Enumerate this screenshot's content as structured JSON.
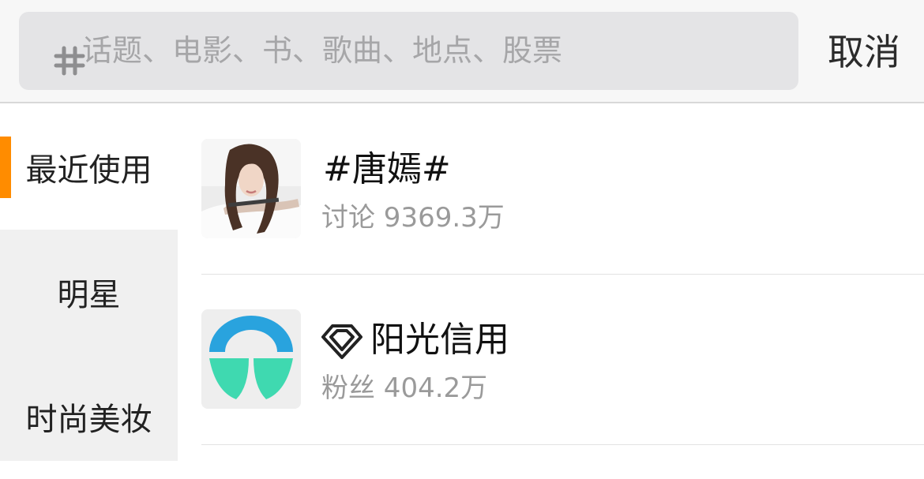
{
  "search": {
    "icon": "hashtag-icon",
    "placeholder": "话题、电影、书、歌曲、地点、股票"
  },
  "header": {
    "cancel_label": "取消"
  },
  "sidebar": {
    "accent_color": "#ff8c00",
    "items": [
      {
        "label": "最近使用",
        "active": true
      },
      {
        "label": "明星",
        "active": false
      },
      {
        "label": "时尚美妆",
        "active": false
      }
    ]
  },
  "list": {
    "items": [
      {
        "title": "#唐嫣#",
        "subtitle": "讨论 9369.3万",
        "thumbnail": "portrait-photo"
      },
      {
        "title": "阳光信用",
        "subtitle": "粉丝 404.2万",
        "thumbnail": "sunshine-credit-logo",
        "badge_icon": "diamond-badge-icon"
      }
    ]
  }
}
